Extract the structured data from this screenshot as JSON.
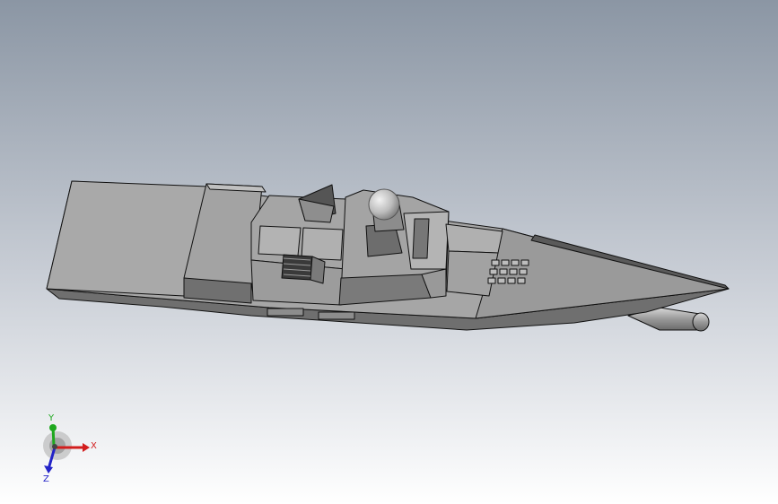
{
  "viewport": {
    "background_top": "#8b96a4",
    "background_bottom": "#ffffff",
    "model_color": "#a6a6a6",
    "model_dark": "#6f6f6f",
    "model_light": "#c4c4c4",
    "edge_color": "#111111"
  },
  "triad": {
    "x_label": "X",
    "y_label": "Y",
    "z_label": "Z",
    "x_color": "#d21d1d",
    "y_color": "#1ea81e",
    "z_color": "#2323c8"
  }
}
